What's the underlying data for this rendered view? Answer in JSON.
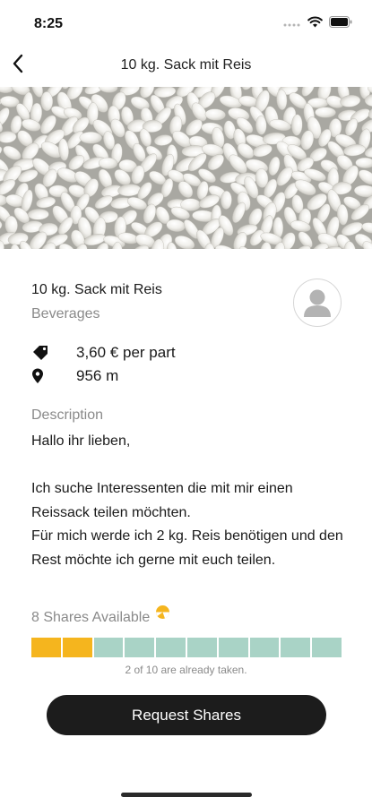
{
  "status_bar": {
    "time": "8:25"
  },
  "nav": {
    "title": "10 kg. Sack mit Reis",
    "back_icon": "chevron-left-icon"
  },
  "item": {
    "title": "10 kg. Sack mit Reis",
    "category": "Beverages",
    "price": "3,60 € per part",
    "distance": "956 m"
  },
  "description": {
    "label": "Description",
    "text": "Hallo ihr lieben,\n\nIch suche Interessenten die mit mir einen Reissack teilen möchten.\nFür mich werde ich 2 kg. Reis benötigen und den Rest möchte ich gerne mit euch teilen."
  },
  "shares": {
    "label": "8 Shares Available",
    "total": 10,
    "taken": 2,
    "caption": "2 of 10 are already taken.",
    "colors": {
      "taken": "#f5b51e",
      "available": "#a9d3c6"
    }
  },
  "actions": {
    "request_label": "Request Shares"
  }
}
